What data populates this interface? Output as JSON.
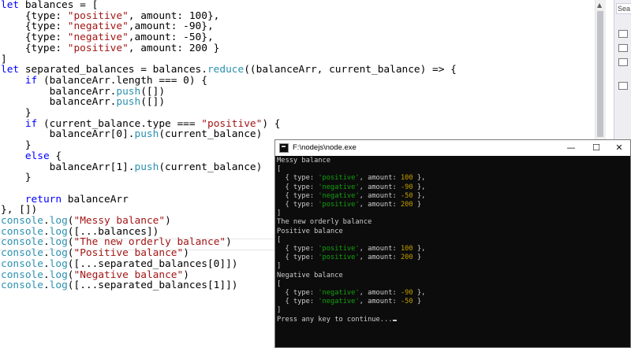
{
  "colors": {
    "keyword": "#0000ff",
    "string": "#a31515",
    "object": "#2b91af",
    "text": "#000000",
    "console_bg": "#0c0c0c",
    "console_text": "#cccccc",
    "console_string": "#13a10e",
    "console_number": "#c19c00"
  },
  "editor": {
    "lines": [
      [
        {
          "c": "kw",
          "t": "let"
        },
        {
          "c": "txt",
          "t": " balances = ["
        }
      ],
      [
        {
          "c": "txt",
          "t": "    {type: "
        },
        {
          "c": "str",
          "t": "\"positive\""
        },
        {
          "c": "txt",
          "t": ", amount: 100},"
        }
      ],
      [
        {
          "c": "txt",
          "t": "    {type: "
        },
        {
          "c": "str",
          "t": "\"negative\""
        },
        {
          "c": "txt",
          "t": ",amount: -90},"
        }
      ],
      [
        {
          "c": "txt",
          "t": "    {type: "
        },
        {
          "c": "str",
          "t": "\"negative\""
        },
        {
          "c": "txt",
          "t": ",amount: -50},"
        }
      ],
      [
        {
          "c": "txt",
          "t": "    {type: "
        },
        {
          "c": "str",
          "t": "\"positive\""
        },
        {
          "c": "txt",
          "t": ", amount: 200 }"
        }
      ],
      [
        {
          "c": "txt",
          "t": "]"
        }
      ],
      [
        {
          "c": "kw",
          "t": "let"
        },
        {
          "c": "txt",
          "t": " separated_balances = balances."
        },
        {
          "c": "obj",
          "t": "reduce"
        },
        {
          "c": "txt",
          "t": "((balanceArr, current_balance) => {"
        }
      ],
      [
        {
          "c": "txt",
          "t": "    "
        },
        {
          "c": "kw",
          "t": "if"
        },
        {
          "c": "txt",
          "t": " (balanceArr.length === 0) {"
        }
      ],
      [
        {
          "c": "txt",
          "t": "        balanceArr."
        },
        {
          "c": "obj",
          "t": "push"
        },
        {
          "c": "txt",
          "t": "([])"
        }
      ],
      [
        {
          "c": "txt",
          "t": "        balanceArr."
        },
        {
          "c": "obj",
          "t": "push"
        },
        {
          "c": "txt",
          "t": "([])"
        }
      ],
      [
        {
          "c": "txt",
          "t": "    }"
        }
      ],
      [
        {
          "c": "txt",
          "t": "    "
        },
        {
          "c": "kw",
          "t": "if"
        },
        {
          "c": "txt",
          "t": " (current_balance.type === "
        },
        {
          "c": "str",
          "t": "\"positive\""
        },
        {
          "c": "txt",
          "t": ") {"
        }
      ],
      [
        {
          "c": "txt",
          "t": "        balanceArr[0]."
        },
        {
          "c": "obj",
          "t": "push"
        },
        {
          "c": "txt",
          "t": "(current_balance)"
        }
      ],
      [
        {
          "c": "txt",
          "t": "    }"
        }
      ],
      [
        {
          "c": "txt",
          "t": "    "
        },
        {
          "c": "kw",
          "t": "else"
        },
        {
          "c": "txt",
          "t": " {"
        }
      ],
      [
        {
          "c": "txt",
          "t": "        balanceArr[1]."
        },
        {
          "c": "obj",
          "t": "push"
        },
        {
          "c": "txt",
          "t": "(current_balance)"
        }
      ],
      [
        {
          "c": "txt",
          "t": "    }"
        }
      ],
      [
        {
          "c": "txt",
          "t": ""
        }
      ],
      [
        {
          "c": "txt",
          "t": "    "
        },
        {
          "c": "kw",
          "t": "return"
        },
        {
          "c": "txt",
          "t": " balanceArr"
        }
      ],
      [
        {
          "c": "txt",
          "t": "}, [])"
        }
      ],
      [
        {
          "c": "obj",
          "t": "console"
        },
        {
          "c": "txt",
          "t": "."
        },
        {
          "c": "obj",
          "t": "log"
        },
        {
          "c": "txt",
          "t": "("
        },
        {
          "c": "str",
          "t": "\"Messy balance\""
        },
        {
          "c": "txt",
          "t": ")"
        }
      ],
      [
        {
          "c": "obj",
          "t": "console"
        },
        {
          "c": "txt",
          "t": "."
        },
        {
          "c": "obj",
          "t": "log"
        },
        {
          "c": "txt",
          "t": "([...balances])"
        }
      ],
      [
        {
          "c": "obj",
          "t": "console"
        },
        {
          "c": "txt",
          "t": "."
        },
        {
          "c": "obj",
          "t": "log"
        },
        {
          "c": "txt",
          "t": "("
        },
        {
          "c": "str",
          "t": "\"The new orderly balance\""
        },
        {
          "c": "txt",
          "t": ")"
        }
      ],
      [
        {
          "c": "obj",
          "t": "console"
        },
        {
          "c": "txt",
          "t": "."
        },
        {
          "c": "obj",
          "t": "log"
        },
        {
          "c": "txt",
          "t": "("
        },
        {
          "c": "str",
          "t": "\"Positive balance\""
        },
        {
          "c": "txt",
          "t": ")"
        }
      ],
      [
        {
          "c": "obj",
          "t": "console"
        },
        {
          "c": "txt",
          "t": "."
        },
        {
          "c": "obj",
          "t": "log"
        },
        {
          "c": "txt",
          "t": "([...separated_balances[0]])"
        }
      ],
      [
        {
          "c": "obj",
          "t": "console"
        },
        {
          "c": "txt",
          "t": "."
        },
        {
          "c": "obj",
          "t": "log"
        },
        {
          "c": "txt",
          "t": "("
        },
        {
          "c": "str",
          "t": "\"Negative balance\""
        },
        {
          "c": "txt",
          "t": ")"
        }
      ],
      [
        {
          "c": "obj",
          "t": "console"
        },
        {
          "c": "txt",
          "t": "."
        },
        {
          "c": "obj",
          "t": "log"
        },
        {
          "c": "txt",
          "t": "([...separated_balances[1]])"
        }
      ]
    ]
  },
  "side_panel": {
    "search_label": "Sea"
  },
  "console": {
    "title": "F:\\nodejs\\node.exe",
    "minimize_glyph": "—",
    "maximize_glyph": "☐",
    "close_glyph": "✕",
    "lines": [
      [
        {
          "c": "cgray",
          "t": "Messy balance"
        }
      ],
      [
        {
          "c": "cgray",
          "t": "["
        }
      ],
      [
        {
          "c": "cgray",
          "t": "  { type: "
        },
        {
          "c": "cgreen",
          "t": "'positive'"
        },
        {
          "c": "cgray",
          "t": ", amount: "
        },
        {
          "c": "cyellow",
          "t": "100"
        },
        {
          "c": "cgray",
          "t": " },"
        }
      ],
      [
        {
          "c": "cgray",
          "t": "  { type: "
        },
        {
          "c": "cgreen",
          "t": "'negative'"
        },
        {
          "c": "cgray",
          "t": ", amount: "
        },
        {
          "c": "cyellow",
          "t": "-90"
        },
        {
          "c": "cgray",
          "t": " },"
        }
      ],
      [
        {
          "c": "cgray",
          "t": "  { type: "
        },
        {
          "c": "cgreen",
          "t": "'negative'"
        },
        {
          "c": "cgray",
          "t": ", amount: "
        },
        {
          "c": "cyellow",
          "t": "-50"
        },
        {
          "c": "cgray",
          "t": " },"
        }
      ],
      [
        {
          "c": "cgray",
          "t": "  { type: "
        },
        {
          "c": "cgreen",
          "t": "'positive'"
        },
        {
          "c": "cgray",
          "t": ", amount: "
        },
        {
          "c": "cyellow",
          "t": "200"
        },
        {
          "c": "cgray",
          "t": " }"
        }
      ],
      [
        {
          "c": "cgray",
          "t": "]"
        }
      ],
      [
        {
          "c": "cgray",
          "t": "The new orderly balance"
        }
      ],
      [
        {
          "c": "cgray",
          "t": "Positive balance"
        }
      ],
      [
        {
          "c": "cgray",
          "t": "["
        }
      ],
      [
        {
          "c": "cgray",
          "t": "  { type: "
        },
        {
          "c": "cgreen",
          "t": "'positive'"
        },
        {
          "c": "cgray",
          "t": ", amount: "
        },
        {
          "c": "cyellow",
          "t": "100"
        },
        {
          "c": "cgray",
          "t": " },"
        }
      ],
      [
        {
          "c": "cgray",
          "t": "  { type: "
        },
        {
          "c": "cgreen",
          "t": "'positive'"
        },
        {
          "c": "cgray",
          "t": ", amount: "
        },
        {
          "c": "cyellow",
          "t": "200"
        },
        {
          "c": "cgray",
          "t": " }"
        }
      ],
      [
        {
          "c": "cgray",
          "t": "]"
        }
      ],
      [
        {
          "c": "cgray",
          "t": "Negative balance"
        }
      ],
      [
        {
          "c": "cgray",
          "t": "["
        }
      ],
      [
        {
          "c": "cgray",
          "t": "  { type: "
        },
        {
          "c": "cgreen",
          "t": "'negative'"
        },
        {
          "c": "cgray",
          "t": ", amount: "
        },
        {
          "c": "cyellow",
          "t": "-90"
        },
        {
          "c": "cgray",
          "t": " },"
        }
      ],
      [
        {
          "c": "cgray",
          "t": "  { type: "
        },
        {
          "c": "cgreen",
          "t": "'negative'"
        },
        {
          "c": "cgray",
          "t": ", amount: "
        },
        {
          "c": "cyellow",
          "t": "-50"
        },
        {
          "c": "cgray",
          "t": " }"
        }
      ],
      [
        {
          "c": "cgray",
          "t": "]"
        }
      ],
      [
        {
          "c": "cgray",
          "t": "Press any key to continue..."
        }
      ]
    ]
  }
}
